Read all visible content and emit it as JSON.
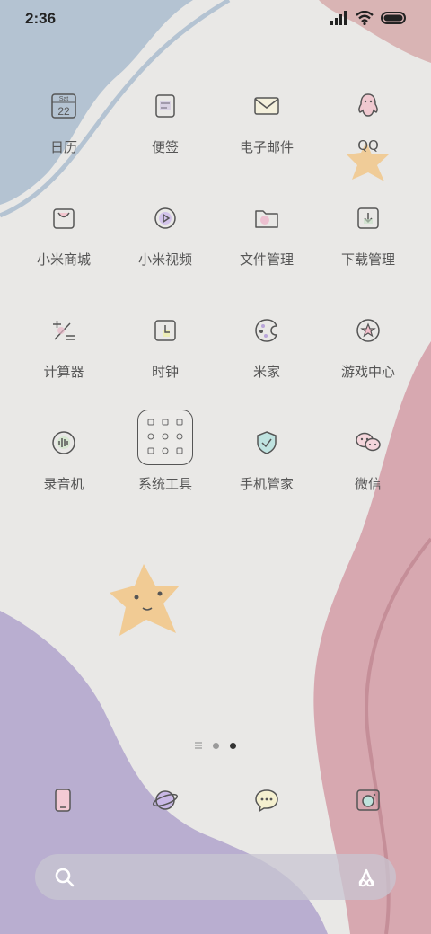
{
  "status_bar": {
    "time": "2:36"
  },
  "calendar_day": "Sat",
  "calendar_date": "22",
  "apps": [
    {
      "label": "日历",
      "icon": "calendar-icon"
    },
    {
      "label": "便签",
      "icon": "notes-icon"
    },
    {
      "label": "电子邮件",
      "icon": "mail-icon"
    },
    {
      "label": "QQ",
      "icon": "qq-penguin-icon"
    },
    {
      "label": "小米商城",
      "icon": "shopping-bag-icon"
    },
    {
      "label": "小米视频",
      "icon": "video-play-icon"
    },
    {
      "label": "文件管理",
      "icon": "folder-icon"
    },
    {
      "label": "下载管理",
      "icon": "download-icon"
    },
    {
      "label": "计算器",
      "icon": "calculator-icon"
    },
    {
      "label": "时钟",
      "icon": "clock-icon"
    },
    {
      "label": "米家",
      "icon": "smart-home-icon"
    },
    {
      "label": "游戏中心",
      "icon": "game-star-icon"
    },
    {
      "label": "录音机",
      "icon": "recorder-icon"
    },
    {
      "label": "系统工具",
      "icon": "folder-system-tools-icon"
    },
    {
      "label": "手机管家",
      "icon": "security-shield-icon"
    },
    {
      "label": "微信",
      "icon": "wechat-icon"
    }
  ],
  "page_indicator": {
    "pages": 3,
    "active": 3
  },
  "dock": [
    {
      "icon": "phone-icon"
    },
    {
      "icon": "browser-planet-icon"
    },
    {
      "icon": "messages-icon"
    },
    {
      "icon": "camera-icon"
    }
  ],
  "search_bar": {
    "left_icon": "search-icon",
    "right_icon": "assistant-icon"
  },
  "colors": {
    "wallpaper_bg": "#e9e8e6",
    "blue_blob": "#b4c3d2",
    "pink_blob": "#d7a8b0",
    "purple_blob": "#b9aed0",
    "star": "#f1c98f"
  }
}
